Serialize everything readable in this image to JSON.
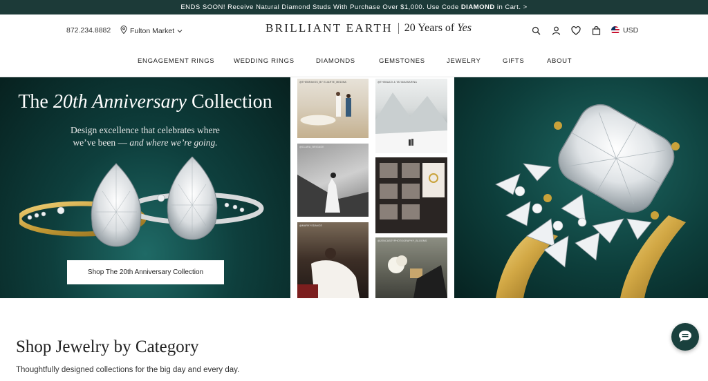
{
  "promo": {
    "prefix": "ENDS SOON! Receive Natural Diamond Studs With Purchase Over $1,000. Use Code ",
    "code": "DIAMOND",
    "suffix": " in Cart. >"
  },
  "header": {
    "phone": "872.234.8882",
    "store": "Fulton Market",
    "logo": {
      "name": "BRILLIANT EARTH",
      "tagline_prefix": "20 Years of ",
      "tagline_italic": "Yes"
    },
    "currency": "USD",
    "icons": [
      "search-icon",
      "account-icon",
      "heart-icon",
      "bag-icon",
      "us-flag-icon"
    ]
  },
  "nav": {
    "items": [
      "ENGAGEMENT RINGS",
      "WEDDING RINGS",
      "DIAMONDS",
      "GEMSTONES",
      "JEWELRY",
      "GIFTS",
      "ABOUT"
    ]
  },
  "hero": {
    "title_pre": "The ",
    "title_italic": "20th Anniversary",
    "title_post": " Collection",
    "subtitle_line1": "Design excellence that celebrates where",
    "subtitle_line2_pre": "we’ve been — ",
    "subtitle_line2_italic": "and where we’re going.",
    "cta": "Shop The 20th Anniversary Collection"
  },
  "collage": {
    "photos": [
      {
        "caption": "@THEBRAVOS_BY ELIARTE_MEDINA"
      },
      {
        "caption": "@THEBAZZI & TATIANASARINA"
      },
      {
        "caption": "@CLARA_BRIGADE"
      },
      {
        "caption": ""
      },
      {
        "caption": "@MARKYSDANCE"
      },
      {
        "caption": "@JENCASEYPHOTOGRAPHY_BLOOMS"
      }
    ]
  },
  "section": {
    "title": "Shop Jewelry by Category",
    "subtitle": "Thoughtfully designed collections for the big day and every day."
  },
  "colors": {
    "promo_bg": "#1c3a38",
    "hero_green": "#0e3f3d",
    "gold": "#c9a23a",
    "chat_bg": "#19403d"
  }
}
